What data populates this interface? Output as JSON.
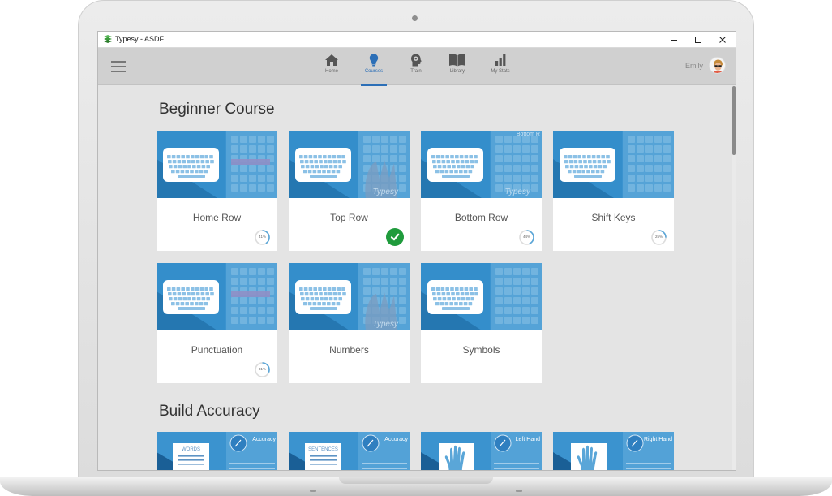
{
  "window": {
    "title": "Typesy - ASDF",
    "minimize_icon": "minimize-icon",
    "maximize_icon": "maximize-icon",
    "close_icon": "close-icon"
  },
  "nav": {
    "menu_icon": "hamburger-menu-icon",
    "items": [
      {
        "label": "Home",
        "icon": "home-icon",
        "active": false
      },
      {
        "label": "Courses",
        "icon": "lightbulb-icon",
        "active": true
      },
      {
        "label": "Train",
        "icon": "brain-head-icon",
        "active": false
      },
      {
        "label": "Library",
        "icon": "book-icon",
        "active": false
      },
      {
        "label": "My Stats",
        "icon": "bar-chart-icon",
        "active": false
      }
    ],
    "user": {
      "name": "Emily",
      "avatar": "user-avatar"
    }
  },
  "colors": {
    "accent": "#2c6fb7",
    "card_blue": "#2f8ac8",
    "card_dark_blue": "#1a5f96",
    "complete_green": "#1f9b3c"
  },
  "sections": [
    {
      "title": "Beginner Course",
      "cards": [
        {
          "title": "Home Row",
          "progress_label": "41%",
          "progress": 0.41,
          "completed": false,
          "overlay": ""
        },
        {
          "title": "Top Row",
          "progress_label": "",
          "progress": 1.0,
          "completed": true,
          "overlay": "Typesy"
        },
        {
          "title": "Bottom Row",
          "progress_label": "44%",
          "progress": 0.44,
          "completed": false,
          "overlay": "Typesy",
          "corner_text": "Bottom R"
        },
        {
          "title": "Shift Keys",
          "progress_label": "25%",
          "progress": 0.25,
          "completed": false,
          "overlay": ""
        },
        {
          "title": "Punctuation",
          "progress_label": "31%",
          "progress": 0.31,
          "completed": false,
          "overlay": ""
        },
        {
          "title": "Numbers",
          "progress_label": "",
          "progress": 0,
          "completed": false,
          "overlay": "Typesy"
        },
        {
          "title": "Symbols",
          "progress_label": "",
          "progress": 0,
          "completed": false,
          "overlay": ""
        }
      ]
    },
    {
      "title": "Build Accuracy",
      "cards": [
        {
          "label": "Accuracy",
          "doc_label": "WORDS"
        },
        {
          "label": "Accuracy",
          "doc_label": "SENTENCES"
        },
        {
          "label": "Left Hand",
          "doc_label": ""
        },
        {
          "label": "Right Hand",
          "doc_label": ""
        }
      ]
    }
  ]
}
